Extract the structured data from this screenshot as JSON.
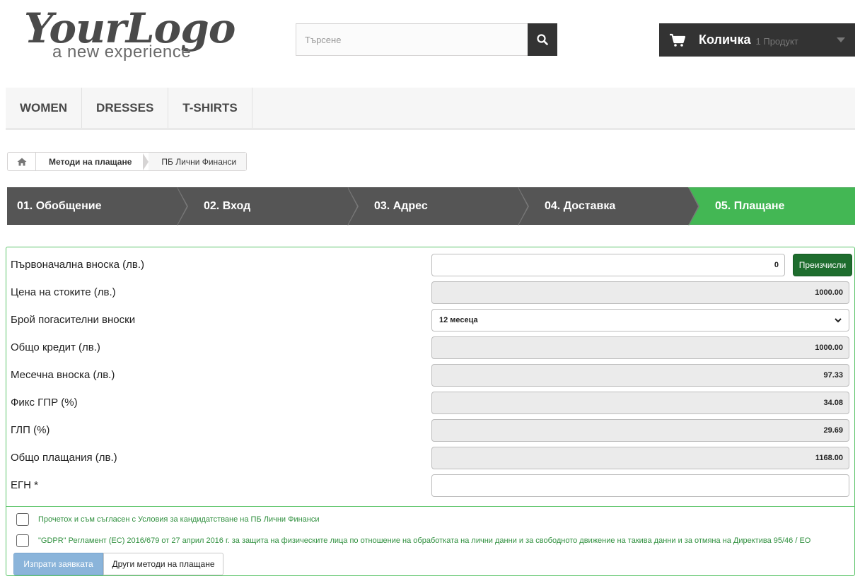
{
  "header": {
    "logo_main": "YourLogo",
    "logo_sub": "a new experience",
    "search_placeholder": "Търсене",
    "search_icon": "search-icon",
    "cart_label": "Количка",
    "cart_qty": "1 Продукт",
    "cart_icon": "cart-icon"
  },
  "menu": {
    "items": [
      {
        "label": "WOMEN"
      },
      {
        "label": "DRESSES"
      },
      {
        "label": "T-SHIRTS"
      }
    ]
  },
  "breadcrumb": {
    "home_icon": "home-icon",
    "items": [
      {
        "label": "Методи на плащане"
      },
      {
        "label": "ПБ Лични Финанси"
      }
    ]
  },
  "steps": [
    {
      "label": "01. Обобщение",
      "active": false
    },
    {
      "label": "02. Вход",
      "active": false
    },
    {
      "label": "03. Адрес",
      "active": false
    },
    {
      "label": "04. Доставка",
      "active": false
    },
    {
      "label": "05. Плащане",
      "active": true
    }
  ],
  "form": {
    "rows": [
      {
        "label": "Първоначална вноска (лв.)",
        "value": "0"
      },
      {
        "label": "Цена на стоките (лв.)",
        "value": "1000.00"
      },
      {
        "label": "Брой погасителни вноски",
        "value": "12 месеца"
      },
      {
        "label": "Общо кредит (лв.)",
        "value": "1000.00"
      },
      {
        "label": "Месечна вноска (лв.)",
        "value": "97.33"
      },
      {
        "label": "Фикс ГПР (%)",
        "value": "34.08"
      },
      {
        "label": "ГЛП (%)",
        "value": "29.69"
      },
      {
        "label": "Общо плащания (лв.)",
        "value": "1168.00"
      },
      {
        "label": "ЕГН *",
        "value": ""
      }
    ],
    "recalc_label": "Преизчисли",
    "terms_text": "Прочетох и съм съгласен с Условия за кандидатстване на ПБ Лични Финанси",
    "gdpr_text": "\"GDPR\" Регламент (ЕС) 2016/679 от 27 април 2016 г. за защита на физическите лица по отношение на обработката на лични данни и за свободното движение на такива данни и за отмяна на Директива 95/46 / ЕО",
    "submit_label": "Изпрати заявката",
    "other_methods_label": "Други методи на плащане"
  },
  "colors": {
    "accent_green": "#43b754",
    "dark_green_button": "#1e6d2e",
    "submit_blue": "#8ab4da",
    "dark": "#333333"
  }
}
